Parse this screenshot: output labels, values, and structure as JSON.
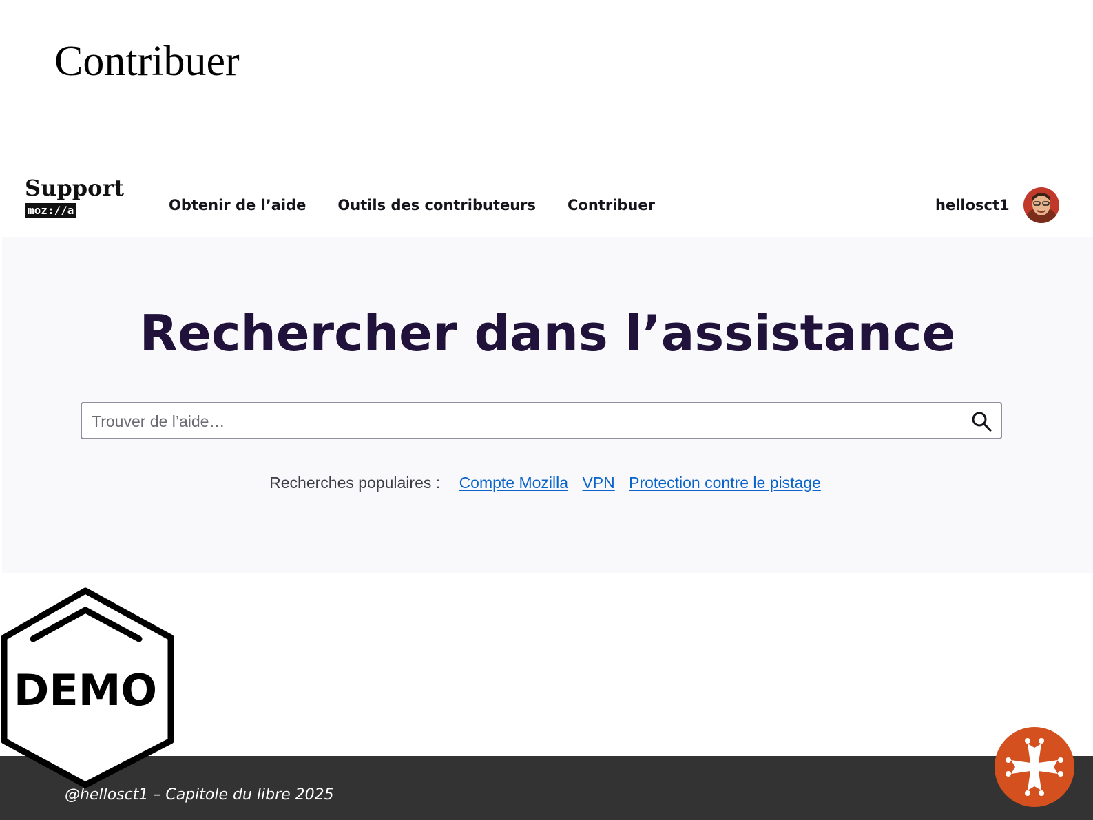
{
  "slide": {
    "title": "Contribuer",
    "footer_text": "@hellosct1 – Capitole du libre 2025",
    "demo_label": "DEMO"
  },
  "header": {
    "logo_word": "Support",
    "logo_badge": "moz://a",
    "nav": [
      {
        "label": "Obtenir de l’aide"
      },
      {
        "label": "Outils des contributeurs"
      },
      {
        "label": "Contribuer"
      }
    ],
    "username": "hellosct1"
  },
  "hero": {
    "title": "Rechercher dans l’assistance",
    "search_placeholder": "Trouver de l’aide…",
    "search_value": "",
    "popular_label": "Recherches populaires :",
    "popular_links": [
      {
        "label": "Compte Mozilla"
      },
      {
        "label": "VPN"
      },
      {
        "label": "Protection contre le pistage"
      }
    ]
  },
  "icons": {
    "search": "search-icon",
    "avatar": "user-avatar",
    "cross": "occitan-cross-icon"
  },
  "colors": {
    "hero_title": "#20123a",
    "link": "#0a64c9",
    "hero_bg": "#f9f9fb",
    "footer_bg": "#333333",
    "cross_bg": "#d4501e"
  }
}
